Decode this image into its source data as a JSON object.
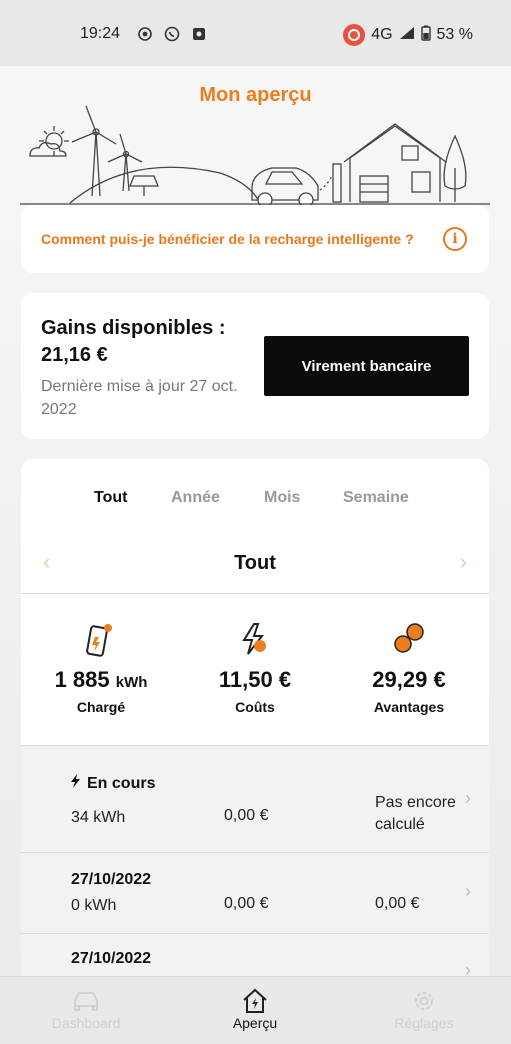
{
  "status_bar": {
    "time": "19:24",
    "network": "4G",
    "battery": "53 %"
  },
  "header": {
    "title": "Mon aperçu"
  },
  "help": {
    "text": "Comment puis-je bénéficier de la recharge intelligente ?"
  },
  "gains": {
    "title": "Gains disponibles :",
    "value": "21,16 €",
    "updated": "Dernière mise à jour 27 oct. 2022",
    "button": "Virement bancaire"
  },
  "tabs": [
    {
      "label": "Tout",
      "active": true
    },
    {
      "label": "Année",
      "active": false
    },
    {
      "label": "Mois",
      "active": false
    },
    {
      "label": "Semaine",
      "active": false
    }
  ],
  "period": {
    "title": "Tout",
    "prev": "‹",
    "next": "›"
  },
  "stats": [
    {
      "value": "1 885",
      "unit": "kWh",
      "label": "Chargé",
      "icon": "charging-phone-icon"
    },
    {
      "value": "11,50 €",
      "unit": "",
      "label": "Coûts",
      "icon": "bolt-cost-icon"
    },
    {
      "value": "29,29 €",
      "unit": "",
      "label": "Avantages",
      "icon": "coins-icon"
    }
  ],
  "sessions": [
    {
      "title": "En cours",
      "energy": "34 kWh",
      "cost": "0,00 €",
      "benefit": "Pas encore calculé"
    },
    {
      "title": "27/10/2022",
      "energy": "0 kWh",
      "cost": "0,00 €",
      "benefit": "0,00 €"
    },
    {
      "title": "27/10/2022",
      "energy": "",
      "cost": "",
      "benefit": ""
    }
  ],
  "nav": [
    {
      "label": "Dashboard",
      "icon": "car-icon",
      "active": false
    },
    {
      "label": "Aperçu",
      "icon": "house-bolt-icon",
      "active": true
    },
    {
      "label": "Réglages",
      "icon": "gear-icon",
      "active": false
    }
  ],
  "colors": {
    "accent": "#ee7d1f",
    "button": "#0b0b0b"
  }
}
